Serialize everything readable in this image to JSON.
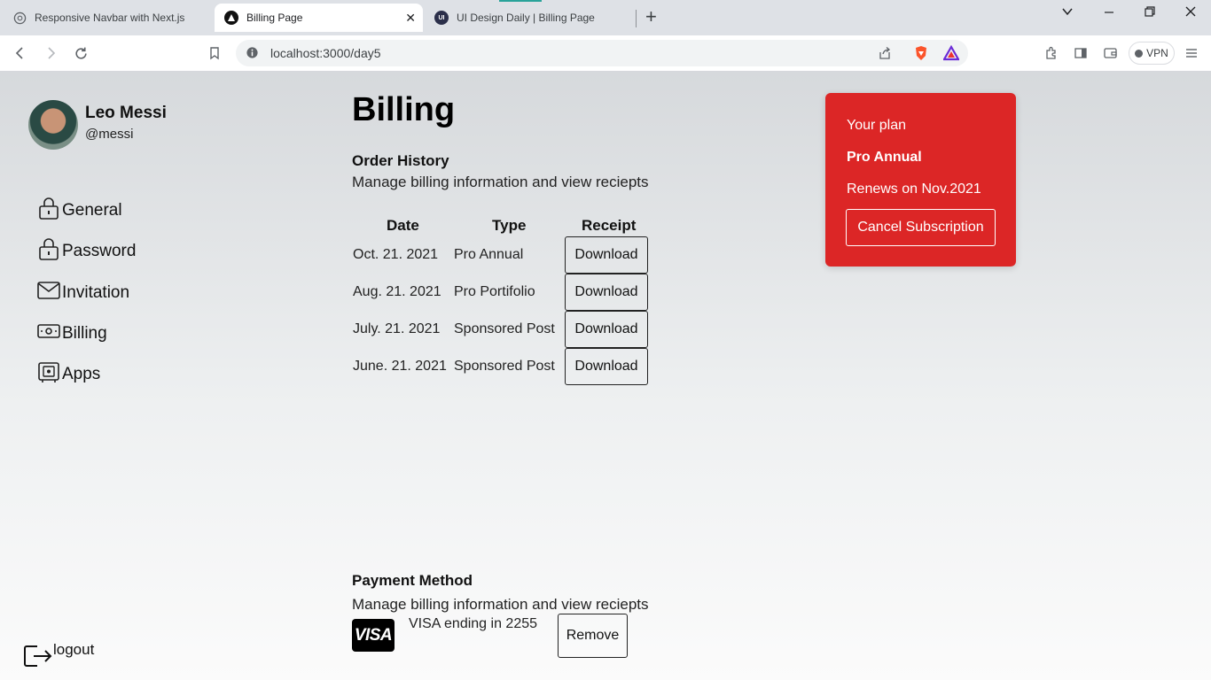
{
  "browser": {
    "tabs": [
      {
        "title": "Responsive Navbar with Next.js"
      },
      {
        "title": "Billing Page"
      },
      {
        "title": "UI Design Daily | Billing Page"
      }
    ],
    "url": "localhost:3000/day5",
    "vpn_label": "VPN"
  },
  "user": {
    "name": "Leo Messi",
    "handle": "@messi"
  },
  "sidebar": {
    "items": [
      {
        "label": "General",
        "icon": "lock-icon"
      },
      {
        "label": "Password",
        "icon": "lock-icon"
      },
      {
        "label": "Invitation",
        "icon": "envelope-icon"
      },
      {
        "label": "Billing",
        "icon": "money-icon"
      },
      {
        "label": "Apps",
        "icon": "apps-icon"
      }
    ],
    "logout_label": "logout"
  },
  "main": {
    "title": "Billing",
    "order_history": {
      "heading": "Order History",
      "description": "Manage billing information and view reciepts",
      "columns": [
        "Date",
        "Type",
        "Receipt"
      ],
      "rows": [
        {
          "date": "Oct. 21. 2021",
          "type": "Pro Annual",
          "receipt": "Download"
        },
        {
          "date": "Aug. 21. 2021",
          "type": "Pro Portifolio",
          "receipt": "Download"
        },
        {
          "date": "July. 21. 2021",
          "type": "Sponsored Post",
          "receipt": "Download"
        },
        {
          "date": "June. 21. 2021",
          "type": "Sponsored Post",
          "receipt": "Download"
        }
      ]
    },
    "payment_method": {
      "heading": "Payment Method",
      "description": "Manage billing information and view reciepts",
      "card_brand": "VISA",
      "card_text": "VISA ending in 2255",
      "remove_label": "Remove"
    }
  },
  "plan": {
    "label": "Your plan",
    "name": "Pro Annual",
    "renews": "Renews on Nov.2021",
    "cancel_label": "Cancel Subscription",
    "color": "#dc2626"
  }
}
